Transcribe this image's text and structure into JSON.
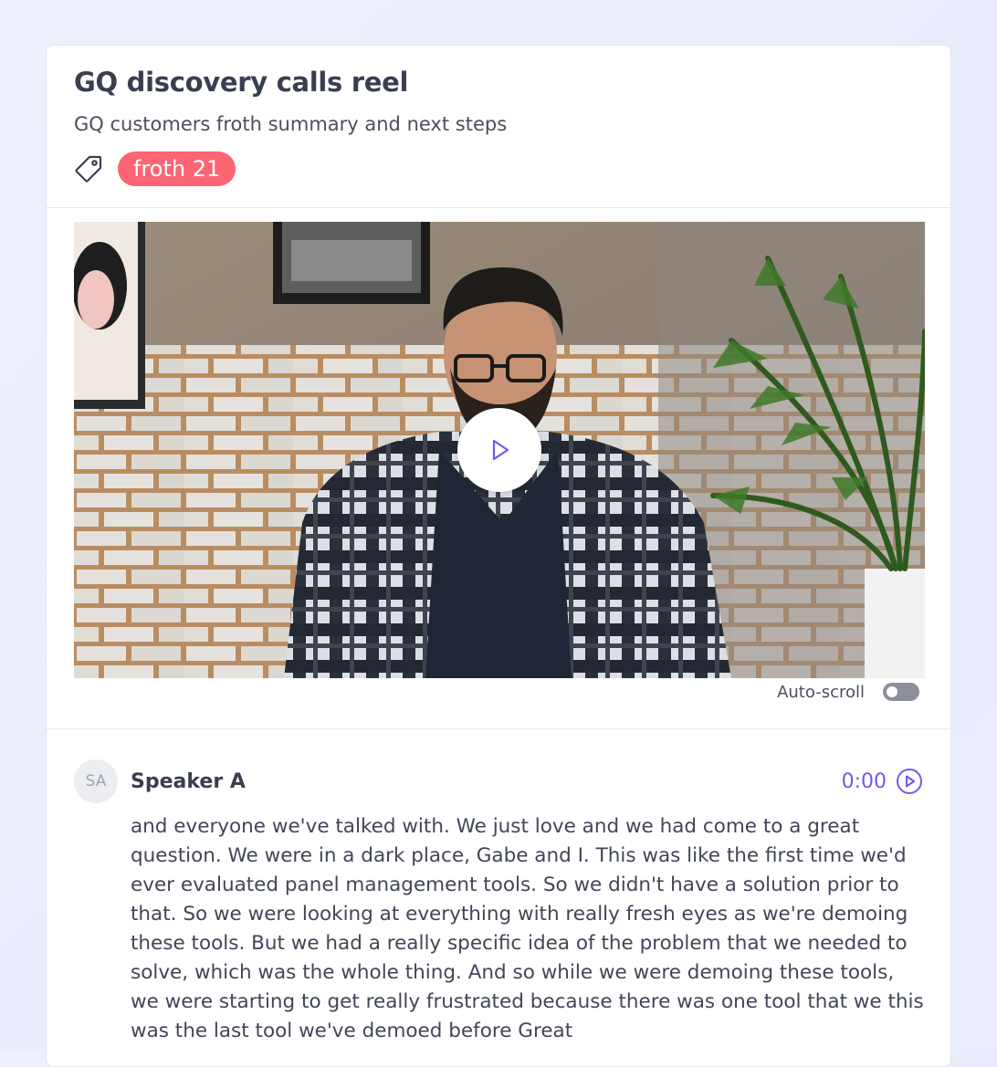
{
  "header": {
    "title": "GQ discovery calls reel",
    "subtitle": "GQ customers froth summary and next steps",
    "tag_icon": "tag-icon",
    "tag_label": "froth 21",
    "tag_color": "#fb6672"
  },
  "video": {
    "play_icon": "play-icon",
    "accent_color": "#6b5cf0"
  },
  "autoscroll": {
    "label": "Auto-scroll",
    "enabled": false
  },
  "transcript": {
    "entries": [
      {
        "avatar_initials": "SA",
        "speaker": "Speaker A",
        "timestamp": "0:00",
        "timestamp_icon": "play-circle-icon",
        "text": "and everyone we've talked with. We just love and we had come to a great question. We were in a dark place, Gabe and I. This was like the first time we'd ever evaluated panel management tools. So we didn't have a solution prior to that. So we were looking at everything with really fresh eyes as we're demoing these tools. But we had a really specific idea of the problem that we needed to solve, which was the whole thing. And so while we were demoing these tools, we were starting to get really frustrated because there was one tool that we this was the last tool we've demoed before Great"
      }
    ]
  }
}
